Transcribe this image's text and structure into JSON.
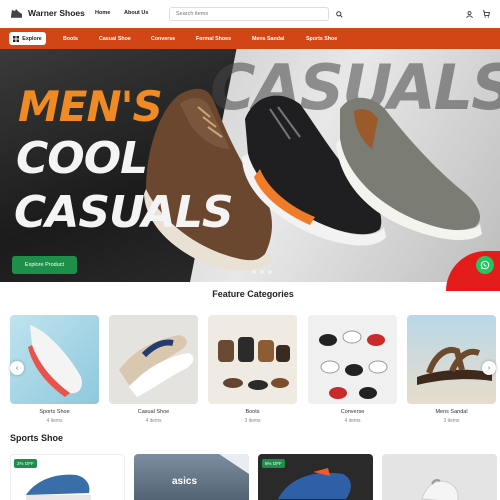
{
  "header": {
    "brand": "Warner Shoes",
    "nav": [
      "Home",
      "About Us"
    ],
    "search_placeholder": "Search items"
  },
  "categories_bar": {
    "explore_label": "Explore",
    "links": [
      "Boots",
      "Casual Shoe",
      "Converse",
      "Formal Shoes",
      "Mens Sandal",
      "Sports Shoe"
    ]
  },
  "hero": {
    "line1": "MEN'S",
    "line2": "COOL",
    "line3": "CASUALS",
    "background_word": "CASUALS",
    "cta_label": "Explore Product"
  },
  "feature": {
    "title": "Feature Categories",
    "items": [
      {
        "name": "Sports Shoe",
        "count": "4 items"
      },
      {
        "name": "Casual Shoe",
        "count": "4 items"
      },
      {
        "name": "Boots",
        "count": "3 items"
      },
      {
        "name": "Converse",
        "count": "4 items"
      },
      {
        "name": "Mens Sandal",
        "count": "3 items"
      }
    ]
  },
  "sports": {
    "title": "Sports Shoe",
    "badges": [
      "2% OFF",
      "6% OFF"
    ],
    "brand_logo": "asics"
  },
  "colors": {
    "accent": "#d24514",
    "cta": "#1e8f4a",
    "whatsapp": "#22c55e"
  }
}
